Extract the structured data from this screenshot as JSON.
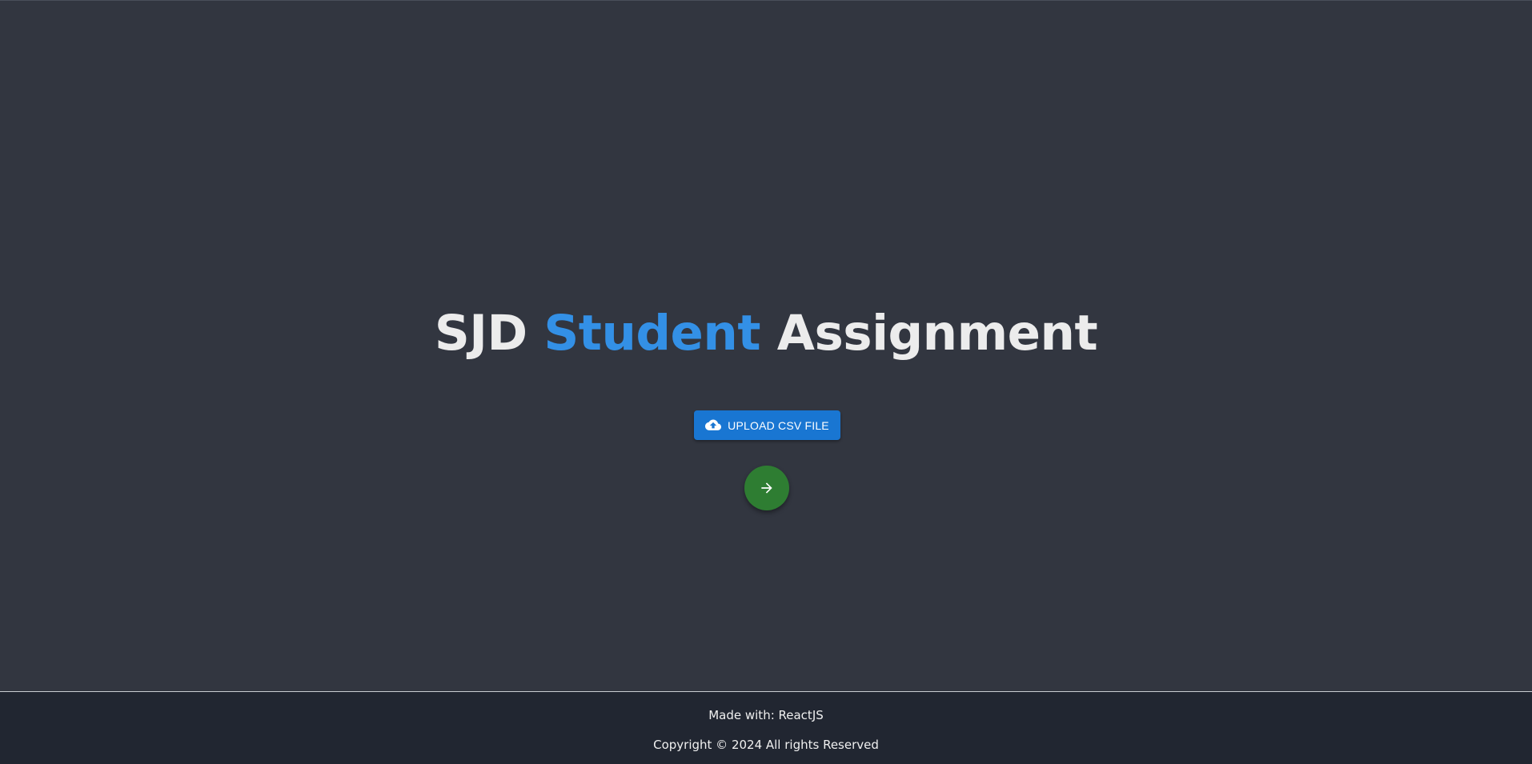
{
  "header": {
    "title_part1": "SJD",
    "title_part2": "Student",
    "title_part3": "Assignment"
  },
  "actions": {
    "upload_label": "UPLOAD CSV FILE",
    "upload_icon": "cloud-upload-icon",
    "next_icon": "arrow-right-icon"
  },
  "footer": {
    "made_with": "Made with: ReactJS",
    "copyright": "Copyright © 2024 All rights Reserved"
  },
  "colors": {
    "background": "#323640",
    "footer_background": "#212631",
    "accent_blue": "#3390e6",
    "upload_button": "#1976d2",
    "next_button": "#2e7d32"
  }
}
